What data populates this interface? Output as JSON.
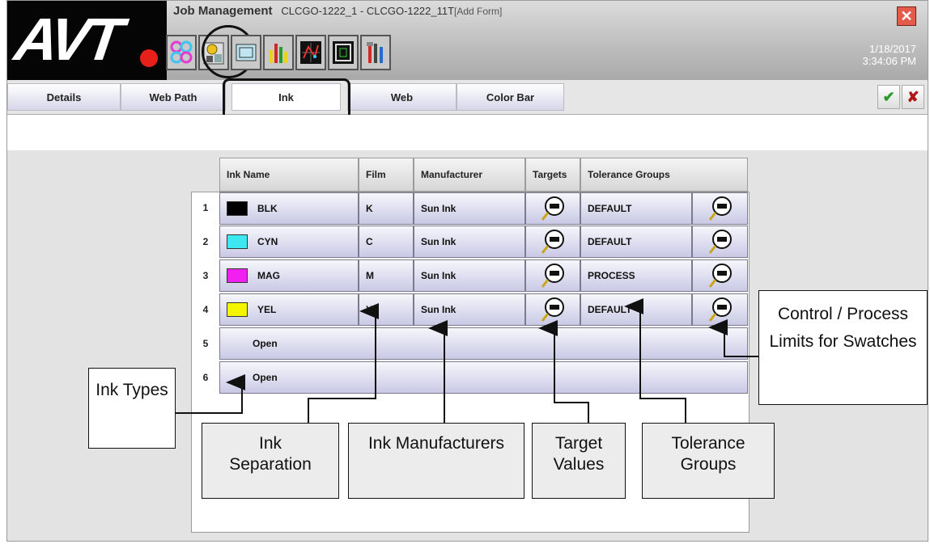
{
  "app": {
    "logo_text": "AVT",
    "module": "Job Management",
    "job": "CLCGO-1222_1 - CLCGO-1222_11T",
    "form_state": "[Add Form]",
    "date": "1/18/2017",
    "time": "3:34:06 PM"
  },
  "toolbar": {
    "icons": [
      "ink-dots-icon",
      "job-settings-icon",
      "window-icon",
      "bar-chart-icon",
      "plot-icon",
      "frame-icon",
      "tools-icon"
    ]
  },
  "tabs": [
    {
      "label": "Details"
    },
    {
      "label": "Web Path"
    },
    {
      "label": "Ink"
    },
    {
      "label": "Web"
    },
    {
      "label": "Color Bar"
    }
  ],
  "actions": {
    "accept": "✔",
    "cancel": "✘"
  },
  "grid": {
    "columns": [
      "Ink Name",
      "Film",
      "Manufacturer",
      "Targets",
      "Tolerance Groups"
    ],
    "rows": [
      {
        "num": "1",
        "name": "BLK",
        "film": "K",
        "manufacturer": "Sun Ink",
        "tolerance": "DEFAULT",
        "color": "#000000"
      },
      {
        "num": "2",
        "name": "CYN",
        "film": "C",
        "manufacturer": "Sun Ink",
        "tolerance": "DEFAULT",
        "color": "#3ee8f0"
      },
      {
        "num": "3",
        "name": "MAG",
        "film": "M",
        "manufacturer": "Sun Ink",
        "tolerance": "PROCESS",
        "color": "#f020f0"
      },
      {
        "num": "4",
        "name": "YEL",
        "film": "Y",
        "manufacturer": "Sun Ink",
        "tolerance": "DEFAULT",
        "color": "#f5f500"
      },
      {
        "num": "5",
        "name": "Open"
      },
      {
        "num": "6",
        "name": "Open"
      }
    ]
  },
  "callouts": {
    "ink_types": "Ink Types",
    "ink_separation": "Ink Separation",
    "ink_manufacturers": "Ink Manufacturers",
    "target_values": "Target Values",
    "tolerance_groups": "Tolerance Groups",
    "control_limits": "Control / Process Limits for Swatches"
  }
}
